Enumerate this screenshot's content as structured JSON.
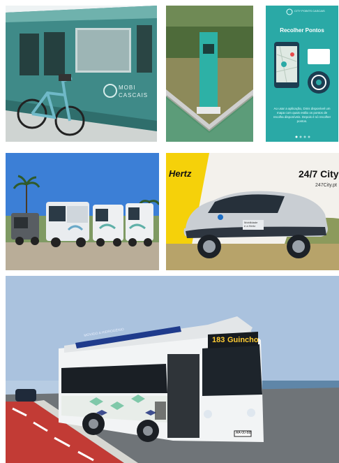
{
  "tram_tile": {
    "brand_line1": "MOBI",
    "brand_line2": "CASCAIS"
  },
  "app_tile": {
    "logo_text": "CITY POINTS CASCAIS",
    "title": "Recolher Pontos",
    "description": "Ao usar a aplicação, Dinis disponível um mapa com quais estão os pontos de recolha disponíveis. Depois é só recolher pontos."
  },
  "hertz_tile": {
    "brand": "Hertz",
    "headline": "24/7 City",
    "url": "247City.pt",
    "door_line1": "Mobilidade",
    "door_line2": "e a Hertz"
  },
  "bus_tile": {
    "roof_banner": "MOVIDO A HIDROGÉNIO",
    "route_number": "183",
    "destination": "Guincho",
    "plate": "AA-00-BB"
  },
  "colors": {
    "tram_teal": "#3f8a88",
    "app_teal": "#2aa9a6",
    "hertz_yellow": "#f5d10a",
    "bike_lane_red": "#c23b35",
    "sky_blue": "#3c7fd6"
  }
}
